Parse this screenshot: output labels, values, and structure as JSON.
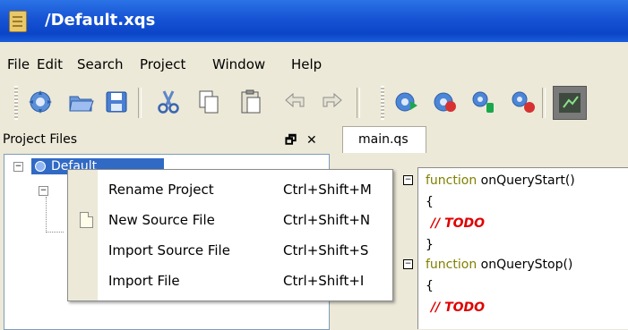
{
  "window": {
    "title": "/Default.xqs"
  },
  "menubar": [
    "File",
    "Edit",
    "Search",
    "Project",
    "Window",
    "Help"
  ],
  "toolbar": {
    "buttons": [
      "new-project-icon",
      "open-icon",
      "save-icon",
      "cut-icon",
      "copy-icon",
      "paste-icon",
      "undo-icon",
      "redo-icon",
      "run-icon",
      "stop-icon",
      "debug-run-icon",
      "debug-stop-icon",
      "terminal-icon"
    ]
  },
  "project_panel": {
    "title": "Project Files",
    "buttons": {
      "float": "🗗",
      "close": "✕"
    },
    "root_label": "Default"
  },
  "editor": {
    "tab": "main.qs",
    "lines": [
      {
        "kw": "function",
        "rest": " onQueryStart()"
      },
      {
        "text": "{"
      },
      {
        "comment": "// TODO"
      },
      {
        "text": "}"
      },
      {
        "kw": "function",
        "rest": " onQueryStop()"
      },
      {
        "text": "{"
      },
      {
        "comment": "// TODO"
      }
    ]
  },
  "context_menu": {
    "items": [
      {
        "label": "Rename Project",
        "shortcut": "Ctrl+Shift+M",
        "icon": ""
      },
      {
        "label": "New Source File",
        "shortcut": "Ctrl+Shift+N",
        "icon": "new-file-icon"
      },
      {
        "label": "Import Source File",
        "shortcut": "Ctrl+Shift+S",
        "icon": ""
      },
      {
        "label": "Import File",
        "shortcut": "Ctrl+Shift+I",
        "icon": ""
      }
    ]
  },
  "colors": {
    "titlebar": "#0B45C8",
    "selection": "#316AC5",
    "keyword": "#808000",
    "comment": "#E00000"
  }
}
